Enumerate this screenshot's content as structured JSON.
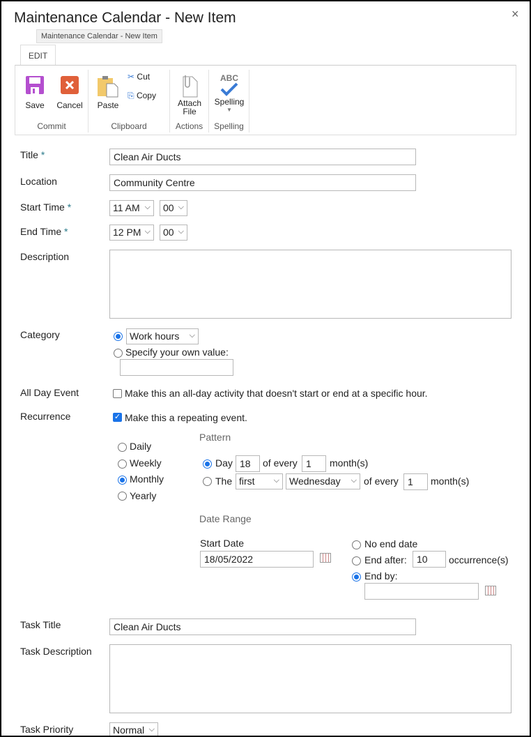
{
  "dialog": {
    "title": "Maintenance Calendar - New Item",
    "tooltip": "Maintenance Calendar - New Item",
    "close": "×"
  },
  "ribbon": {
    "tab": "EDIT",
    "groups": {
      "commit": "Commit",
      "clipboard": "Clipboard",
      "actions": "Actions",
      "spelling": "Spelling"
    },
    "save": "Save",
    "cancel": "Cancel",
    "paste": "Paste",
    "cut": "Cut",
    "copy": "Copy",
    "attach1": "Attach",
    "attach2": "File",
    "spelling": "Spelling",
    "abc": "ABC"
  },
  "form": {
    "title_label": "Title",
    "title_value": "Clean Air Ducts",
    "location_label": "Location",
    "location_value": "Community Centre",
    "start_label": "Start Time",
    "start_hour": "11 AM",
    "start_min": "00",
    "end_label": "End Time",
    "end_hour": "12 PM",
    "end_min": "00",
    "required": "*",
    "description_label": "Description",
    "category_label": "Category",
    "category_value": "Work hours",
    "specify_own": "Specify your own value:",
    "allday_label": "All Day Event",
    "allday_text": "Make this an all-day activity that doesn't start or end at a specific hour.",
    "recurrence_label": "Recurrence",
    "recurrence_text": "Make this a repeating event.",
    "freq": [
      "Daily",
      "Weekly",
      "Monthly",
      "Yearly"
    ],
    "pattern_heading": "Pattern",
    "day_label": "Day",
    "day_value": "18",
    "of_every": "of every",
    "every_value": "1",
    "months": "month(s)",
    "the_label": "The",
    "ordinal": "first",
    "weekday": "Wednesday",
    "of_every2": "of every",
    "every_value2": "1",
    "months2": "month(s)",
    "date_range_heading": "Date Range",
    "start_date_label": "Start Date",
    "start_date_value": "18/05/2022",
    "no_end": "No end date",
    "end_after": "End after:",
    "occurrences_value": "10",
    "occurrences": "occurrence(s)",
    "end_by": "End by:",
    "task_title_label": "Task Title",
    "task_title_value": "Clean Air Ducts",
    "task_desc_label": "Task Description",
    "task_priority_label": "Task Priority",
    "task_priority_value": "Normal"
  }
}
